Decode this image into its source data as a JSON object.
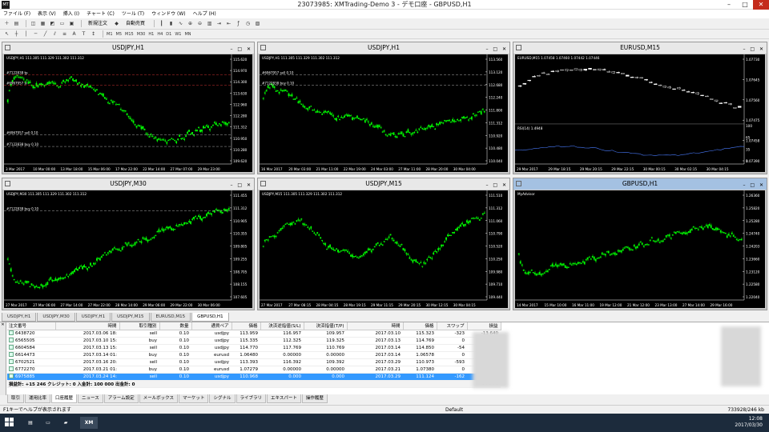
{
  "window": {
    "title": "23073985: XMTrading-Demo 3 - デモ口座 - GBPUSD,H1",
    "logo": "MT"
  },
  "menu": [
    "ファイル (F)",
    "表示 (V)",
    "挿入 (I)",
    "チャート (C)",
    "ツール (T)",
    "ウィンドウ (W)",
    "ヘルプ (H)"
  ],
  "toolbar": {
    "new_order": "新規注文",
    "auto_trading": "自動売買",
    "timeframes": [
      "M1",
      "M5",
      "M15",
      "M30",
      "H1",
      "H4",
      "D1",
      "W1",
      "MN"
    ]
  },
  "charts": [
    {
      "title": "USDJPY,H1",
      "info": "USDJPY,H1  111.305 111.329 111.302 111.312",
      "prices": [
        "115.620",
        "114.970",
        "114.300",
        "113.630",
        "112.960",
        "112.280",
        "111.312",
        "110.950",
        "110.280",
        "109.620"
      ],
      "dates": [
        "3 Mar 2017",
        "10 Mar 00:00",
        "13 Mar 18:00",
        "15 Mar 06:00",
        "17 Mar 22:00",
        "22 Mar 14:00",
        "27 Mar 07:00",
        "29 Mar 23:00"
      ],
      "labels": [
        "#7122838 tp",
        "#6967957 sl",
        "#6967957 sell 0.10",
        "#7122838 buy 0.10"
      ]
    },
    {
      "title": "USDJPY,H1",
      "info": "USDJPY,H1  111.305 111.329 111.302 111.312",
      "prices": [
        "113.560",
        "113.120",
        "112.680",
        "112.240",
        "111.800",
        "111.312",
        "110.920",
        "110.480",
        "110.040"
      ],
      "dates": [
        "16 Mar 2017",
        "20 Mar 03:00",
        "21 Mar 11:00",
        "22 Mar 19:00",
        "24 Mar 03:00",
        "27 Mar 11:00",
        "28 Mar 20:00",
        "30 Mar 04:00"
      ],
      "labels": [
        "#6967957 sell 0.10",
        "#7122838 buy 0.10"
      ]
    },
    {
      "title": "EURUSD,M15",
      "info": "EURUSD,M15  1.07458 1.07460 1.07442 1.07446",
      "prices": [
        "1.07730",
        "1.07645",
        "1.07560",
        "1.07475",
        "1.07458",
        "1.07390"
      ],
      "rsi_label": "RSI(14)  1.4948",
      "rsi_scale": [
        "100",
        "65",
        "35",
        "0"
      ],
      "dates": [
        "29 Mar 2017",
        "29 Mar 18:15",
        "29 Mar 20:15",
        "29 Mar 22:15",
        "30 Mar 00:15",
        "30 Mar 02:15",
        "30 Mar 04:15"
      ]
    },
    {
      "title": "USDJPY,M30",
      "info": "USDJPY,M30  111.305 111.329 111.302 111.312",
      "prices": [
        "111.455",
        "111.312",
        "110.905",
        "110.355",
        "109.805",
        "109.255",
        "108.705",
        "108.155",
        "107.605"
      ],
      "dates": [
        "27 Mar 2017",
        "27 Mar 06:00",
        "27 Mar 14:00",
        "27 Mar 22:00",
        "28 Mar 14:00",
        "29 Mar 06:00",
        "29 Mar 22:00",
        "30 Mar 06:00"
      ],
      "labels": [
        "#7122838 buy 0.10"
      ]
    },
    {
      "title": "USDJPY,M15",
      "info": "USDJPY,M15  111.305 111.329 111.302 111.312",
      "prices": [
        "111.510",
        "111.312",
        "111.060",
        "110.790",
        "110.520",
        "110.250",
        "109.980",
        "109.710",
        "109.440"
      ],
      "dates": [
        "27 Mar 2017",
        "27 Mar 08:15",
        "28 Mar 04:15",
        "28 Mar 19:15",
        "29 Mar 11:15",
        "29 Mar 20:15",
        "30 Mar 12:15",
        "30 Mar 04:15"
      ]
    },
    {
      "title": "GBPUSD,H1",
      "info": "MyAdvisor",
      "prices": [
        "1.26360",
        "1.25820",
        "1.25280",
        "1.24740",
        "1.24203",
        "1.23660",
        "1.23120",
        "1.22580",
        "1.22040"
      ],
      "dates": [
        "14 Mar 2017",
        "15 Mar 10:00",
        "16 Mar 11:00",
        "19 Mar 12:00",
        "21 Mar 12:00",
        "23 Mar 13:00",
        "27 Mar 14:00",
        "29 Mar 16:00"
      ]
    }
  ],
  "chart_tabs": [
    "USDJPY,H1",
    "USDJPY,M30",
    "USDJPY,H1",
    "USDJPY,M15",
    "EURUSD,M15",
    "GBPUSD,H1"
  ],
  "active_chart_tab": 5,
  "terminal": {
    "columns": [
      "注文番号",
      "時間",
      "取引種別",
      "数量",
      "通貨ペア",
      "価格",
      "決済逆指値(S/L)",
      "決済指値(T/P)",
      "時間",
      "価格",
      "スワップ",
      "損益"
    ],
    "rows": [
      [
        "6438720",
        "2017.03.06 18:",
        "sell",
        "0.10",
        "usdjpy",
        "113.959",
        "116.957",
        "109.957",
        "2017.03.10",
        "115.323",
        "-323",
        "-13 640"
      ],
      [
        "6565505",
        "2017.03.10 15:",
        "buy",
        "0.10",
        "usdjpy",
        "115.335",
        "112.325",
        "119.325",
        "2017.03.13",
        "114.769",
        "0",
        "-5 660"
      ],
      [
        "6604584",
        "2017.03.13 15:",
        "sell",
        "0.10",
        "usdjpy",
        "114.770",
        "117.769",
        "110.769",
        "2017.03.14",
        "114.850",
        "-54",
        "-800"
      ],
      [
        "6614473",
        "2017.03.14 01:",
        "buy",
        "0.10",
        "eurusd",
        "1.06480",
        "0.00000",
        "0.00000",
        "2017.03.14",
        "1.06578",
        "0",
        "1 124"
      ],
      [
        "6702521",
        "2017.03.16 20:",
        "sell",
        "0.10",
        "usdjpy",
        "113.393",
        "116.392",
        "109.392",
        "2017.03.29",
        "110.973",
        "-593",
        "24 200"
      ],
      [
        "6772270",
        "2017.03.21 01:",
        "buy",
        "0.10",
        "eurusd",
        "1.07279",
        "0.00000",
        "0.00000",
        "2017.03.21",
        "1.07380",
        "0",
        "1 137"
      ],
      [
        "6975885",
        "2017.03.24 14:",
        "sell",
        "0.10",
        "usdjpy",
        "110.968",
        "0.000",
        "0.000",
        "2017.03.29",
        "111.124",
        "-162",
        "-1 560"
      ]
    ],
    "balance": "損益計: +15 246  クレジット: 0  入金計: 100 000  出金計: 0",
    "total": "84 754",
    "side_label": "ターミナル",
    "tabs": [
      "取引",
      "運用比率",
      "口座履歴",
      "ニュース",
      "アラーム設定",
      "メールボックス",
      "マーケット",
      "シグナル",
      "ライブラリ",
      "エキスパート",
      "操作履歴"
    ],
    "active_tab": 2
  },
  "status": {
    "help": "F1キーでヘルプが表示されます",
    "profile": "Default",
    "traffic": "733928/246 kb"
  },
  "taskbar": {
    "time": "12:08",
    "date": "2017/03/30",
    "app": "XM"
  },
  "colors": {
    "candle": "#00ff00",
    "bg": "#000000",
    "grid": "#333333",
    "selected": "#3399ff"
  }
}
